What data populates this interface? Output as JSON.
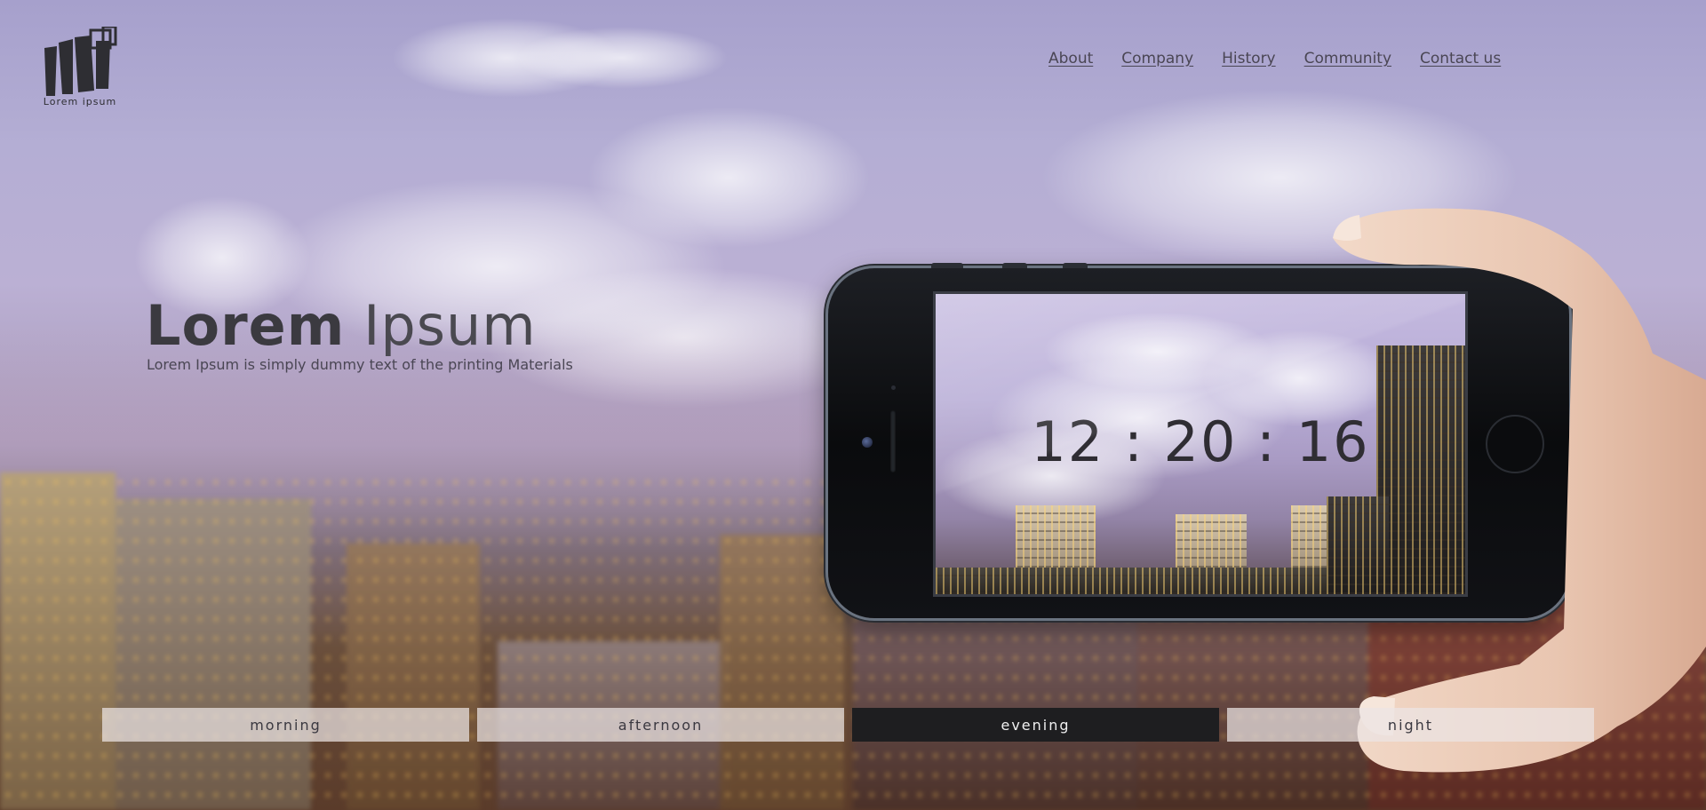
{
  "logo": {
    "text": "Lorem ipsum",
    "icon": "building-logo-icon"
  },
  "nav": {
    "items": [
      "About",
      "Company",
      "History",
      "Community",
      "Contact us"
    ]
  },
  "hero": {
    "title_bold": "Lorem",
    "title_light": "Ipsum",
    "subtitle": "Lorem Ipsum is simply dummy text of the printing Materials"
  },
  "phone": {
    "clock": "12 : 20 : 16"
  },
  "time_buttons": {
    "items": [
      "morning",
      "afternoon",
      "evening",
      "night"
    ],
    "active": "evening"
  },
  "colors": {
    "active_button": "#1e1e20",
    "inactive_button": "#ebe4e4",
    "text_dark": "#3b3a40"
  }
}
